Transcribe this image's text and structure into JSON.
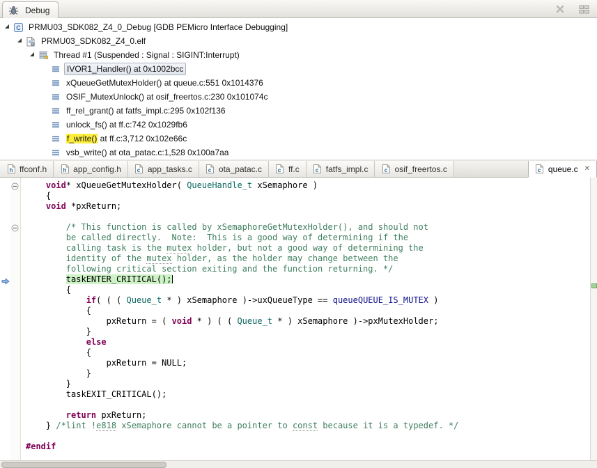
{
  "debug_view": {
    "tab_label": "Debug",
    "toolbar": [
      {
        "icon": "remove-all-terminated-icon"
      },
      {
        "icon": "view-layout-icon"
      }
    ],
    "tree": [
      {
        "indent": 0,
        "icon": "launch",
        "label": "PRMU03_SDK082_Z4_0_Debug [GDB PEMicro Interface Debugging]",
        "expanded": true
      },
      {
        "indent": 1,
        "icon": "elf",
        "label": "PRMU03_SDK082_Z4_0.elf",
        "expanded": true
      },
      {
        "indent": 2,
        "icon": "thread",
        "label": "Thread #1 (Suspended : Signal : SIGINT:Interrupt)",
        "expanded": true
      },
      {
        "indent": 3,
        "icon": "frame",
        "label": "IVOR1_Handler() at 0x1002bcc",
        "selected": true
      },
      {
        "indent": 3,
        "icon": "frame",
        "label": "xQueueGetMutexHolder() at queue.c:551 0x1014376"
      },
      {
        "indent": 3,
        "icon": "frame",
        "label": "OSIF_MutexUnlock() at osif_freertos.c:230 0x101074c"
      },
      {
        "indent": 3,
        "icon": "frame",
        "label": "ff_rel_grant() at fatfs_impl.c:295 0x102f136"
      },
      {
        "indent": 3,
        "icon": "frame",
        "label": "unlock_fs() at ff.c:742 0x1029fb6"
      },
      {
        "indent": 3,
        "icon": "frame",
        "hl": "f_write()",
        "label": " at ff.c:3,712 0x102e66c"
      },
      {
        "indent": 3,
        "icon": "frame",
        "label": "vsb_write() at ota_patac.c:1,528 0x100a7aa"
      }
    ]
  },
  "editor": {
    "close_glyph": "✕",
    "tabs": [
      {
        "label": "ffconf.h",
        "kind": "h"
      },
      {
        "label": "app_config.h",
        "kind": "h"
      },
      {
        "label": "app_tasks.c",
        "kind": "c"
      },
      {
        "label": "ota_patac.c",
        "kind": "c"
      },
      {
        "label": "ff.c",
        "kind": "c"
      },
      {
        "label": "fatfs_impl.c",
        "kind": "c"
      },
      {
        "label": "osif_freertos.c",
        "kind": "c"
      },
      {
        "label": "queue.c",
        "kind": "c",
        "active": true,
        "closable": true
      }
    ]
  },
  "code": {
    "ip_line": 9,
    "folds": [
      0,
      4
    ],
    "lines": [
      [
        {
          "s": "p",
          "t": "    "
        },
        {
          "s": "k",
          "t": "void"
        },
        {
          "s": "p",
          "t": "* xQueueGetMutexHolder( "
        },
        {
          "s": "t",
          "t": "QueueHandle_t"
        },
        {
          "s": "p",
          "t": " xSemaphore )"
        }
      ],
      [
        {
          "s": "p",
          "t": "    {"
        }
      ],
      [
        {
          "s": "p",
          "t": "    "
        },
        {
          "s": "k",
          "t": "void"
        },
        {
          "s": "p",
          "t": " *pxReturn;"
        }
      ],
      [],
      [
        {
          "s": "p",
          "t": "        "
        },
        {
          "s": "c",
          "t": "/* This function is called by xSemaphoreGetMutexHolder(), and should not"
        }
      ],
      [
        {
          "s": "p",
          "t": "        "
        },
        {
          "s": "c",
          "t": "be called directly.  Note:  This is a good way of determining if the"
        }
      ],
      [
        {
          "s": "p",
          "t": "        "
        },
        {
          "s": "c",
          "t": "calling task is the "
        },
        {
          "s": "c sq",
          "t": "mutex"
        },
        {
          "s": "c",
          "t": " holder, but not a good way of determining the"
        }
      ],
      [
        {
          "s": "p",
          "t": "        "
        },
        {
          "s": "c",
          "t": "identity of the "
        },
        {
          "s": "c sq",
          "t": "mutex"
        },
        {
          "s": "c",
          "t": " holder, as the holder may change between the"
        }
      ],
      [
        {
          "s": "p",
          "t": "        "
        },
        {
          "s": "c",
          "t": "following critical section exiting and the function returning. */"
        }
      ],
      [
        {
          "s": "p",
          "t": "        "
        },
        {
          "s": "p hl",
          "t": "taskENTER_CRITICAL();"
        },
        {
          "s": "caret",
          "t": ""
        }
      ],
      [
        {
          "s": "p",
          "t": "        {"
        }
      ],
      [
        {
          "s": "p",
          "t": "            "
        },
        {
          "s": "k",
          "t": "if"
        },
        {
          "s": "p",
          "t": "( ( ( "
        },
        {
          "s": "t",
          "t": "Queue_t"
        },
        {
          "s": "p",
          "t": " * ) xSemaphore )->uxQueueType == "
        },
        {
          "s": "m",
          "t": "queueQUEUE_IS_MUTEX"
        },
        {
          "s": "p",
          "t": " )"
        }
      ],
      [
        {
          "s": "p",
          "t": "            {"
        }
      ],
      [
        {
          "s": "p",
          "t": "                pxReturn = ( "
        },
        {
          "s": "k",
          "t": "void"
        },
        {
          "s": "p",
          "t": " * ) ( ( "
        },
        {
          "s": "t",
          "t": "Queue_t"
        },
        {
          "s": "p",
          "t": " * ) xSemaphore )->pxMutexHolder;"
        }
      ],
      [
        {
          "s": "p",
          "t": "            }"
        }
      ],
      [
        {
          "s": "p",
          "t": "            "
        },
        {
          "s": "k",
          "t": "else"
        }
      ],
      [
        {
          "s": "p",
          "t": "            {"
        }
      ],
      [
        {
          "s": "p",
          "t": "                pxReturn = NULL;"
        }
      ],
      [
        {
          "s": "p",
          "t": "            }"
        }
      ],
      [
        {
          "s": "p",
          "t": "        }"
        }
      ],
      [
        {
          "s": "p",
          "t": "        taskEXIT_CRITICAL();"
        }
      ],
      [],
      [
        {
          "s": "p",
          "t": "        "
        },
        {
          "s": "k",
          "t": "return"
        },
        {
          "s": "p",
          "t": " pxReturn;"
        }
      ],
      [
        {
          "s": "p",
          "t": "    } "
        },
        {
          "s": "c",
          "t": "/*lint !"
        },
        {
          "s": "c sq",
          "t": "e818"
        },
        {
          "s": "c",
          "t": " xSemaphore cannot be a pointer to "
        },
        {
          "s": "c sq",
          "t": "const"
        },
        {
          "s": "c",
          "t": " because it is a typedef. */"
        }
      ],
      [],
      [
        {
          "s": "k",
          "t": "#endif"
        }
      ]
    ]
  },
  "colors": {
    "keyword": "#7f0055",
    "comment": "#3f7f5f",
    "type": "#0b6762",
    "macro": "#10108e",
    "debug_current_line_bg": "#cdf2c6",
    "occurrence_highlight": "#fdee3b",
    "editor_bg": "#ffffff",
    "chrome_bg": "#e7e4df"
  }
}
